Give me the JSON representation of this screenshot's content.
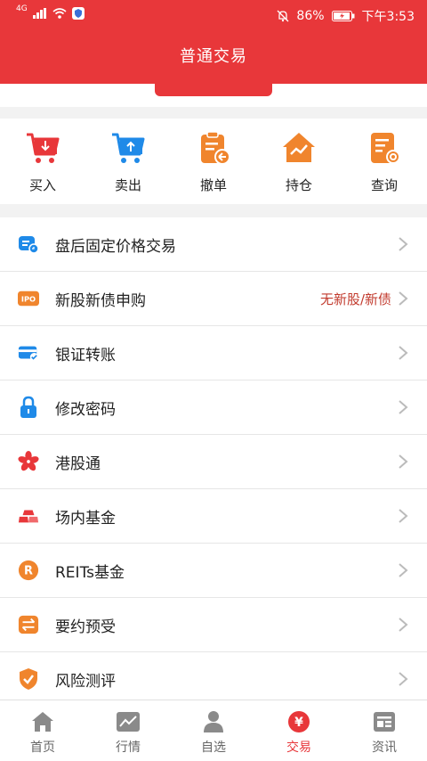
{
  "status_bar": {
    "network": "4G",
    "battery": "86%",
    "time": "下午3:53"
  },
  "header": {
    "title": "普通交易"
  },
  "quick_actions": [
    {
      "label": "买入",
      "icon": "cart-down-icon"
    },
    {
      "label": "卖出",
      "icon": "cart-up-icon"
    },
    {
      "label": "撤单",
      "icon": "clipboard-undo-icon"
    },
    {
      "label": "持仓",
      "icon": "house-chart-icon"
    },
    {
      "label": "查询",
      "icon": "doc-search-icon"
    }
  ],
  "menu": [
    {
      "label": "盘后固定价格交易",
      "value": "",
      "icon": "after-hours-icon"
    },
    {
      "label": "新股新债申购",
      "value": "无新股/新债",
      "icon": "ipo-icon"
    },
    {
      "label": "银证转账",
      "value": "",
      "icon": "bank-card-transfer-icon"
    },
    {
      "label": "修改密码",
      "value": "",
      "icon": "lock-icon"
    },
    {
      "label": "港股通",
      "value": "",
      "icon": "bauhinia-icon"
    },
    {
      "label": "场内基金",
      "value": "",
      "icon": "gold-bars-icon"
    },
    {
      "label": "REITs基金",
      "value": "",
      "icon": "reits-icon"
    },
    {
      "label": "要约预受",
      "value": "",
      "icon": "swap-icon"
    },
    {
      "label": "风险测评",
      "value": "",
      "icon": "shield-check-icon"
    }
  ],
  "tabs": [
    {
      "label": "首页",
      "icon": "home-icon",
      "active": false
    },
    {
      "label": "行情",
      "icon": "chart-line-icon",
      "active": false
    },
    {
      "label": "自选",
      "icon": "person-icon",
      "active": false
    },
    {
      "label": "交易",
      "icon": "yen-circle-icon",
      "active": true
    },
    {
      "label": "资讯",
      "icon": "news-icon",
      "active": false
    }
  ],
  "colors": {
    "brand_red": "#e8373a",
    "accent_orange": "#f0852d",
    "accent_blue": "#1f8ae8",
    "value_red": "#c23b2e"
  }
}
